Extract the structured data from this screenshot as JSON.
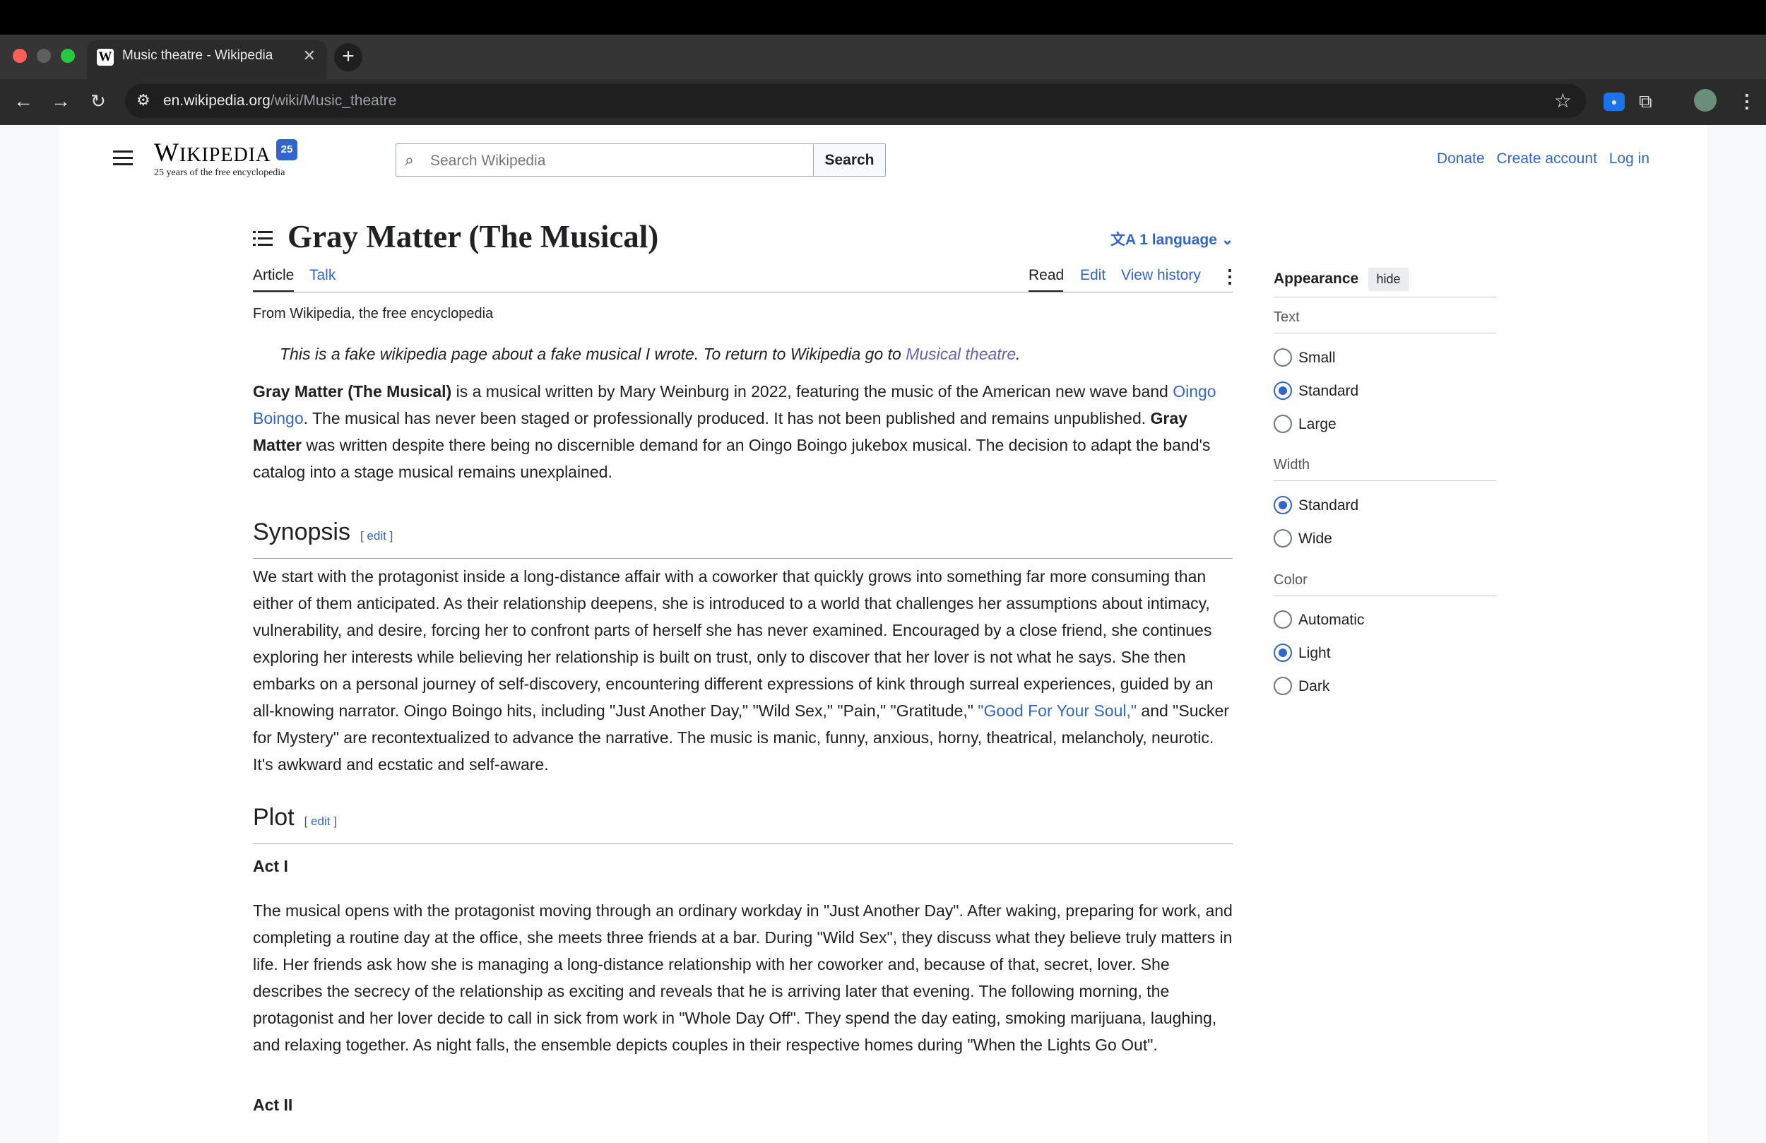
{
  "browser": {
    "tab_title": "Music theatre - Wikipedia",
    "url_host": "en.wikipedia.org",
    "url_path": "/wiki/Music_theatre",
    "traffic_colors": [
      "#ff5f57",
      "#5f5f5f",
      "#28c840"
    ]
  },
  "header": {
    "logo_text": "Wikipedia",
    "logo_badge": "25",
    "tagline": "25 years of the free encyclopedia",
    "search_placeholder": "Search Wikipedia",
    "search_button": "Search",
    "donate": "Donate",
    "create_account": "Create account",
    "log_in": "Log in"
  },
  "article": {
    "title": "Gray Matter (The Musical)",
    "languages": "1 language",
    "tabs": {
      "article": "Article",
      "talk": "Talk",
      "read": "Read",
      "edit": "Edit",
      "history": "View history"
    },
    "from": "From Wikipedia, the free encyclopedia",
    "hatnote": {
      "text": "This is a fake wikipedia page about a fake musical I wrote. To return to Wikipedia go to ",
      "link": "Musical theatre",
      "end": "."
    },
    "lead": {
      "bold1": "Gray Matter (The Musical)",
      "text1": " is a musical written by Mary Weinburg in 2022, featuring the music of the American new wave band ",
      "link": "Oingo Boingo",
      "text2": ". The musical has never been staged or professionally produced. It has not been published and remains unpublished. ",
      "bold2": "Gray Matter",
      "text3": " was written despite there being no discernible demand for an Oingo Boingo jukebox musical. The decision to adapt the band's catalog into a stage musical remains unexplained."
    },
    "synopsis": {
      "heading": "Synopsis",
      "edit": "edit",
      "text1": "We start with the protagonist inside a long-distance affair with a coworker that quickly grows into something far more consuming than either of them anticipated. As their relationship deepens, she is introduced to a world that challenges her assumptions about intimacy, vulnerability, and desire, forcing her to confront parts of herself she has never examined. Encouraged by a close friend, she continues exploring her interests while believing her relationship is built on trust, only to discover that her lover is not what he says. She then embarks on a personal journey of self-discovery, encountering different expressions of kink through surreal experiences, guided by an all-knowing narrator. Oingo Boingo hits, including \"Just Another Day,\" \"Wild Sex,\" \"Pain,\" \"Gratitude,\" ",
      "link": "\"Good For Your Soul,\"",
      "text2": " and \"Sucker for Mystery\" are recontextualized to advance the narrative. The music is manic, funny, anxious, horny, theatrical, melancholy, neurotic. It's awkward and ecstatic and self-aware."
    },
    "plot": {
      "heading": "Plot",
      "edit": "edit",
      "act1": "Act I",
      "act1_text": "The musical opens with the protagonist moving through an ordinary workday in \"Just Another Day\". After waking, preparing for work, and completing a routine day at the office, she meets three friends at a bar. During \"Wild Sex\", they discuss what they believe truly matters in life. Her friends ask how she is managing a long-distance relationship with her coworker and, because of that, secret, lover. She describes the secrecy of the relationship as exciting and reveals that he is arriving later that evening. The following morning, the protagonist and her lover decide to call in sick from work in \"Whole Day Off\". They spend the day eating, smoking marijuana, laughing, and relaxing together. As night falls, the ensemble depicts couples in their respective homes during \"When the Lights Go Out\".",
      "act2": "Act II"
    }
  },
  "appearance": {
    "title": "Appearance",
    "hide": "hide",
    "text_label": "Text",
    "text_options": [
      "Small",
      "Standard",
      "Large"
    ],
    "text_selected": "Standard",
    "width_label": "Width",
    "width_options": [
      "Standard",
      "Wide"
    ],
    "width_selected": "Standard",
    "color_label": "Color",
    "color_options": [
      "Automatic",
      "Light",
      "Dark"
    ],
    "color_selected": "Light"
  }
}
